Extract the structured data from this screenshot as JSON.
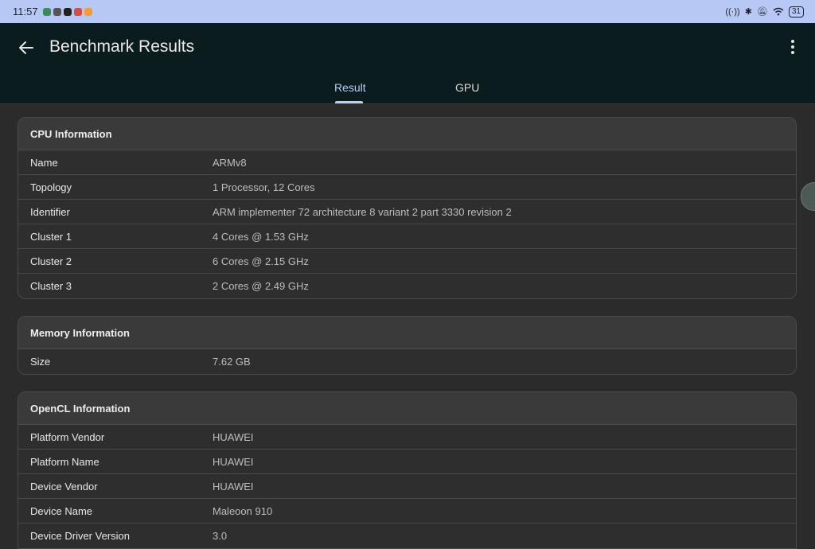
{
  "status": {
    "time": "11:57",
    "battery": "31",
    "notification_icons": [
      "app-icon",
      "app-icon",
      "app-icon",
      "app-icon",
      "app-icon"
    ]
  },
  "appbar": {
    "title": "Benchmark Results",
    "tabs": [
      {
        "label": "Result",
        "selected": true
      },
      {
        "label": "GPU",
        "selected": false
      }
    ]
  },
  "cards": {
    "cpu": {
      "title": "CPU Information",
      "rows": [
        {
          "label": "Name",
          "value": "ARMv8"
        },
        {
          "label": "Topology",
          "value": "1 Processor, 12 Cores"
        },
        {
          "label": "Identifier",
          "value": "ARM implementer 72 architecture 8 variant 2 part 3330 revision 2"
        },
        {
          "label": "Cluster 1",
          "value": "4 Cores @ 1.53 GHz"
        },
        {
          "label": "Cluster 2",
          "value": "6 Cores @ 2.15 GHz"
        },
        {
          "label": "Cluster 3",
          "value": "2 Cores @ 2.49 GHz"
        }
      ]
    },
    "memory": {
      "title": "Memory Information",
      "rows": [
        {
          "label": "Size",
          "value": "7.62 GB"
        }
      ]
    },
    "opencl": {
      "title": "OpenCL Information",
      "rows": [
        {
          "label": "Platform Vendor",
          "value": "HUAWEI"
        },
        {
          "label": "Platform Name",
          "value": "HUAWEI"
        },
        {
          "label": "Device Vendor",
          "value": "HUAWEI"
        },
        {
          "label": "Device Name",
          "value": "Maleoon 910"
        },
        {
          "label": "Device Driver Version",
          "value": "3.0"
        }
      ]
    }
  }
}
